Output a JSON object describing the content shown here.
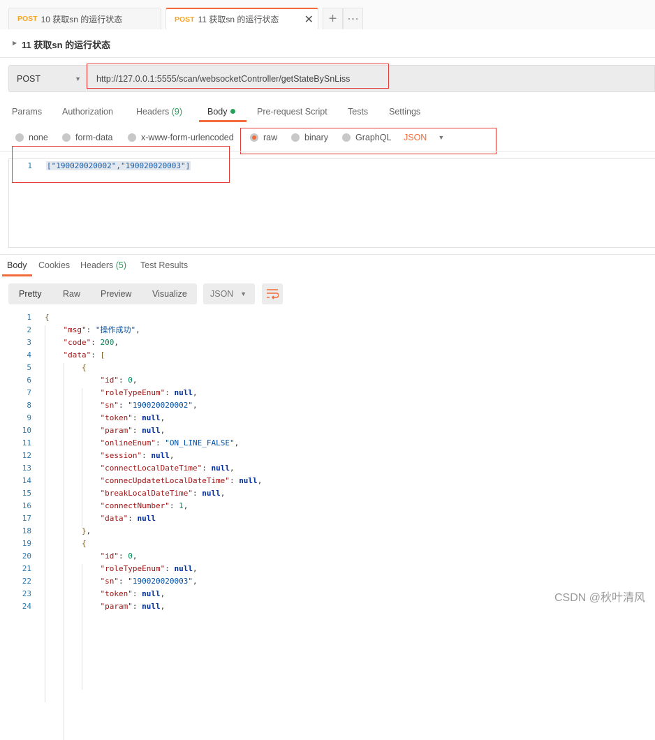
{
  "tabs": [
    {
      "method": "POST",
      "name": "10 获取sn 的运行状态",
      "active": false
    },
    {
      "method": "POST",
      "name": "11 获取sn 的运行状态",
      "active": true
    }
  ],
  "tab_actions": {
    "close": "✕",
    "add": "+",
    "more": "∘∘∘"
  },
  "request": {
    "title": "11 获取sn 的运行状态",
    "method": "POST",
    "url": "http://127.0.0.1:5555/scan/websocketController/getStateBySnLiss"
  },
  "request_tabs": [
    {
      "label": "Params"
    },
    {
      "label": "Authorization"
    },
    {
      "label": "Headers",
      "count": "(9)"
    },
    {
      "label": "Body",
      "active": true
    },
    {
      "label": "Pre-request Script"
    },
    {
      "label": "Tests"
    },
    {
      "label": "Settings"
    }
  ],
  "body_types": [
    {
      "label": "none"
    },
    {
      "label": "form-data"
    },
    {
      "label": "x-www-form-urlencoded"
    },
    {
      "label": "raw",
      "selected": true
    },
    {
      "label": "binary"
    },
    {
      "label": "GraphQL"
    }
  ],
  "body_format": "JSON",
  "request_body": {
    "line": "1",
    "text": "[\"190020020002\",\"190020020003\"]"
  },
  "response_tabs": [
    {
      "label": "Body",
      "active": true
    },
    {
      "label": "Cookies"
    },
    {
      "label": "Headers",
      "count": "(5)"
    },
    {
      "label": "Test Results"
    }
  ],
  "view_modes": [
    "Pretty",
    "Raw",
    "Preview",
    "Visualize"
  ],
  "response_format": "JSON",
  "accent_color": "#f26b3a",
  "response_lines": [
    {
      "i": 0,
      "t": [
        [
          "b",
          "{"
        ]
      ]
    },
    {
      "i": 1,
      "t": [
        [
          "k",
          "\"msg\""
        ],
        [
          "p",
          ": "
        ],
        [
          "s",
          "\"操作成功\""
        ],
        [
          "p",
          ","
        ]
      ]
    },
    {
      "i": 1,
      "t": [
        [
          "k",
          "\"code\""
        ],
        [
          "p",
          ": "
        ],
        [
          "n",
          "200"
        ],
        [
          "p",
          ","
        ]
      ]
    },
    {
      "i": 1,
      "t": [
        [
          "k",
          "\"data\""
        ],
        [
          "p",
          ": "
        ],
        [
          "b",
          "["
        ]
      ]
    },
    {
      "i": 2,
      "t": [
        [
          "b",
          "{"
        ]
      ]
    },
    {
      "i": 3,
      "t": [
        [
          "k",
          "\"id\""
        ],
        [
          "p",
          ": "
        ],
        [
          "n",
          "0"
        ],
        [
          "p",
          ","
        ]
      ]
    },
    {
      "i": 3,
      "t": [
        [
          "k",
          "\"roleTypeEnum\""
        ],
        [
          "p",
          ": "
        ],
        [
          "l",
          "null"
        ],
        [
          "p",
          ","
        ]
      ]
    },
    {
      "i": 3,
      "t": [
        [
          "k",
          "\"sn\""
        ],
        [
          "p",
          ": "
        ],
        [
          "s",
          "\"190020020002\""
        ],
        [
          "p",
          ","
        ]
      ]
    },
    {
      "i": 3,
      "t": [
        [
          "k",
          "\"token\""
        ],
        [
          "p",
          ": "
        ],
        [
          "l",
          "null"
        ],
        [
          "p",
          ","
        ]
      ]
    },
    {
      "i": 3,
      "t": [
        [
          "k",
          "\"param\""
        ],
        [
          "p",
          ": "
        ],
        [
          "l",
          "null"
        ],
        [
          "p",
          ","
        ]
      ]
    },
    {
      "i": 3,
      "t": [
        [
          "k",
          "\"onlineEnum\""
        ],
        [
          "p",
          ": "
        ],
        [
          "s",
          "\"ON_LINE_FALSE\""
        ],
        [
          "p",
          ","
        ]
      ]
    },
    {
      "i": 3,
      "t": [
        [
          "k",
          "\"session\""
        ],
        [
          "p",
          ": "
        ],
        [
          "l",
          "null"
        ],
        [
          "p",
          ","
        ]
      ]
    },
    {
      "i": 3,
      "t": [
        [
          "k",
          "\"connectLocalDateTime\""
        ],
        [
          "p",
          ": "
        ],
        [
          "l",
          "null"
        ],
        [
          "p",
          ","
        ]
      ]
    },
    {
      "i": 3,
      "t": [
        [
          "k",
          "\"connecUpdatetLocalDateTime\""
        ],
        [
          "p",
          ": "
        ],
        [
          "l",
          "null"
        ],
        [
          "p",
          ","
        ]
      ]
    },
    {
      "i": 3,
      "t": [
        [
          "k",
          "\"breakLocalDateTime\""
        ],
        [
          "p",
          ": "
        ],
        [
          "l",
          "null"
        ],
        [
          "p",
          ","
        ]
      ]
    },
    {
      "i": 3,
      "t": [
        [
          "k",
          "\"connectNumber\""
        ],
        [
          "p",
          ": "
        ],
        [
          "n",
          "1"
        ],
        [
          "p",
          ","
        ]
      ]
    },
    {
      "i": 3,
      "t": [
        [
          "k",
          "\"data\""
        ],
        [
          "p",
          ": "
        ],
        [
          "l",
          "null"
        ]
      ]
    },
    {
      "i": 2,
      "t": [
        [
          "b",
          "}"
        ],
        [
          "p",
          ","
        ]
      ]
    },
    {
      "i": 2,
      "t": [
        [
          "b",
          "{"
        ]
      ]
    },
    {
      "i": 3,
      "t": [
        [
          "k",
          "\"id\""
        ],
        [
          "p",
          ": "
        ],
        [
          "n",
          "0"
        ],
        [
          "p",
          ","
        ]
      ]
    },
    {
      "i": 3,
      "t": [
        [
          "k",
          "\"roleTypeEnum\""
        ],
        [
          "p",
          ": "
        ],
        [
          "l",
          "null"
        ],
        [
          "p",
          ","
        ]
      ]
    },
    {
      "i": 3,
      "t": [
        [
          "k",
          "\"sn\""
        ],
        [
          "p",
          ": "
        ],
        [
          "s",
          "\"190020020003\""
        ],
        [
          "p",
          ","
        ]
      ]
    },
    {
      "i": 3,
      "t": [
        [
          "k",
          "\"token\""
        ],
        [
          "p",
          ": "
        ],
        [
          "l",
          "null"
        ],
        [
          "p",
          ","
        ]
      ]
    },
    {
      "i": 3,
      "t": [
        [
          "k",
          "\"param\""
        ],
        [
          "p",
          ": "
        ],
        [
          "l",
          "null"
        ],
        [
          "p",
          ","
        ]
      ]
    }
  ],
  "watermark": "CSDN @秋叶清风"
}
